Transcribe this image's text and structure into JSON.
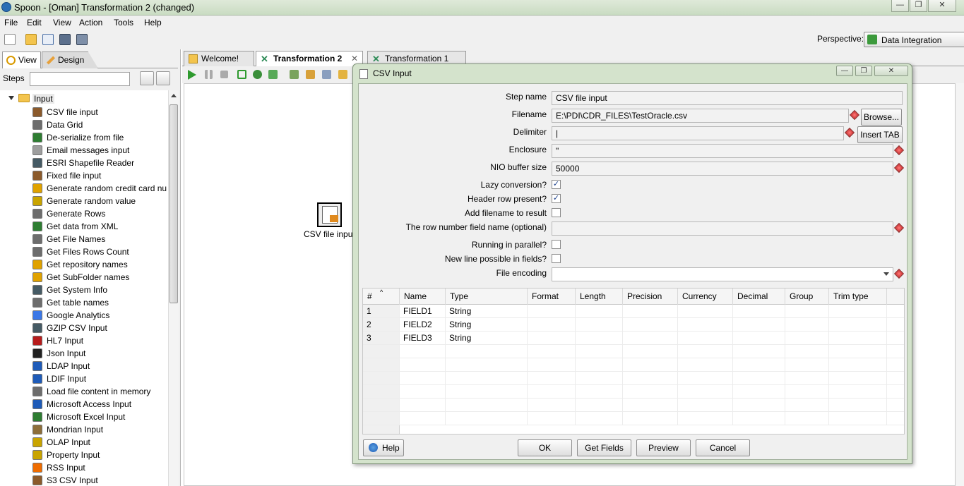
{
  "window": {
    "title": "Spoon - [Oman] Transformation 2 (changed)",
    "minimize": "—",
    "maximize": "❐",
    "close": "✕"
  },
  "menu": {
    "items": [
      "File",
      "Edit",
      "View",
      "Action",
      "Tools",
      "Help"
    ]
  },
  "perspective": {
    "label": "Perspective:",
    "value": "Data Integration"
  },
  "left": {
    "tabs": {
      "view": "View",
      "design": "Design"
    },
    "steps_label": "Steps",
    "search_value": "",
    "group": "Input",
    "items": [
      {
        "label": "CSV file input",
        "icon": "csv-file-icon",
        "color": "#8b5a2b"
      },
      {
        "label": "Data Grid",
        "icon": "grid-icon",
        "color": "#6d6d6d"
      },
      {
        "label": "De-serialize from file",
        "icon": "deserialize-icon",
        "color": "#2e7d32"
      },
      {
        "label": "Email messages input",
        "icon": "email-icon",
        "color": "#9e9e9e"
      },
      {
        "label": "ESRI Shapefile Reader",
        "icon": "esri-icon",
        "color": "#455a64"
      },
      {
        "label": "Fixed file input",
        "icon": "fixed-file-icon",
        "color": "#8b5a2b"
      },
      {
        "label": "Generate random credit card nu",
        "icon": "credit-card-icon",
        "color": "#e0a200"
      },
      {
        "label": "Generate random value",
        "icon": "dice-icon",
        "color": "#c9a400"
      },
      {
        "label": "Generate Rows",
        "icon": "rows-icon",
        "color": "#6d6d6d"
      },
      {
        "label": "Get data from XML",
        "icon": "xml-icon",
        "color": "#2e7d32"
      },
      {
        "label": "Get File Names",
        "icon": "file-names-icon",
        "color": "#6d6d6d"
      },
      {
        "label": "Get Files Rows Count",
        "icon": "rows-count-icon",
        "color": "#6d6d6d"
      },
      {
        "label": "Get repository names",
        "icon": "repository-icon",
        "color": "#e0a200"
      },
      {
        "label": "Get SubFolder names",
        "icon": "subfolder-icon",
        "color": "#e0a200"
      },
      {
        "label": "Get System Info",
        "icon": "system-info-icon",
        "color": "#455a64"
      },
      {
        "label": "Get table names",
        "icon": "table-names-icon",
        "color": "#6d6d6d"
      },
      {
        "label": "Google Analytics",
        "icon": "google-icon",
        "color": "#3b78e7"
      },
      {
        "label": "GZIP CSV Input",
        "icon": "gzip-icon",
        "color": "#455a64"
      },
      {
        "label": "HL7 Input",
        "icon": "hl7-icon",
        "color": "#b71c1c"
      },
      {
        "label": "Json Input",
        "icon": "json-icon",
        "color": "#212121"
      },
      {
        "label": "LDAP Input",
        "icon": "ldap-icon",
        "color": "#1e5bb8"
      },
      {
        "label": "LDIF Input",
        "icon": "ldif-icon",
        "color": "#1e5bb8"
      },
      {
        "label": "Load file content in memory",
        "icon": "load-file-icon",
        "color": "#6d6d6d"
      },
      {
        "label": "Microsoft Access Input",
        "icon": "access-icon",
        "color": "#1e5bb8"
      },
      {
        "label": "Microsoft Excel Input",
        "icon": "excel-icon",
        "color": "#2e7d32"
      },
      {
        "label": "Mondrian Input",
        "icon": "mondrian-icon",
        "color": "#8d6e3a"
      },
      {
        "label": "OLAP Input",
        "icon": "olap-icon",
        "color": "#c9a400"
      },
      {
        "label": "Property Input",
        "icon": "property-icon",
        "color": "#c9a400"
      },
      {
        "label": "RSS Input",
        "icon": "rss-icon",
        "color": "#ef6c00"
      },
      {
        "label": "S3 CSV Input",
        "icon": "s3-icon",
        "color": "#8b5a2b"
      }
    ]
  },
  "tabs": [
    {
      "label": "Welcome!",
      "icon": "welcome-icon"
    },
    {
      "label": "Transformation 2",
      "icon": "transformation-icon",
      "active": true,
      "close": "✕"
    },
    {
      "label": "Transformation 1",
      "icon": "transformation-icon"
    }
  ],
  "canvas": {
    "step_label": "CSV file input"
  },
  "dialog": {
    "title": "CSV Input",
    "fields": {
      "step_name": {
        "label": "Step name",
        "value": "CSV file input"
      },
      "filename": {
        "label": "Filename",
        "value": "E:\\PDI\\CDR_FILES\\TestOracle.csv"
      },
      "delimiter": {
        "label": "Delimiter",
        "value": "|"
      },
      "enclosure": {
        "label": "Enclosure",
        "value": "\""
      },
      "nio_buffer": {
        "label": "NIO buffer size",
        "value": "50000"
      },
      "lazy_conversion": {
        "label": "Lazy conversion?",
        "checked": "✓"
      },
      "header_row": {
        "label": "Header row present?",
        "checked": "✓"
      },
      "add_filename": {
        "label": "Add filename to result",
        "checked": ""
      },
      "row_number_field": {
        "label": "The row number field name (optional)",
        "value": ""
      },
      "running_parallel": {
        "label": "Running in parallel?",
        "checked": ""
      },
      "new_line": {
        "label": "New line possible in fields?",
        "checked": ""
      },
      "file_encoding": {
        "label": "File encoding",
        "value": ""
      }
    },
    "buttons": {
      "browse": "Browse...",
      "insert_tab": "Insert TAB",
      "help": "Help",
      "ok": "OK",
      "get_fields": "Get Fields",
      "preview": "Preview",
      "cancel": "Cancel"
    },
    "table": {
      "columns": [
        "#",
        "Name",
        "Type",
        "Format",
        "Length",
        "Precision",
        "Currency",
        "Decimal",
        "Group",
        "Trim type"
      ],
      "rows": [
        [
          "1",
          "FIELD1",
          "String"
        ],
        [
          "2",
          "FIELD2",
          "String"
        ],
        [
          "3",
          "FIELD3",
          "String"
        ]
      ]
    }
  }
}
